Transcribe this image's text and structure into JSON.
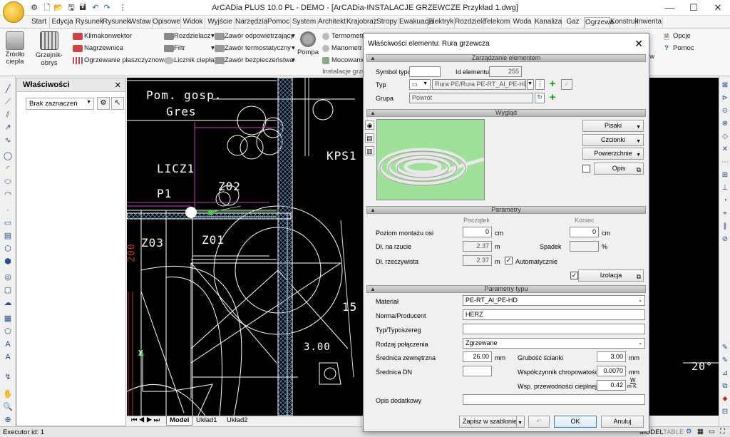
{
  "window": {
    "title": "ArCADia PLUS 10.0 PL - DEMO - [ArCADia-INSTALACJE GRZEWCZE Przykład 1.dwg]",
    "minimize": "—",
    "maximize": "☐",
    "close": "✕"
  },
  "tabs": [
    "Start",
    "Edycja",
    "Rysunek",
    "Rysunek",
    "Wstaw",
    "Opisowe",
    "Widok",
    "Wyjście",
    "Narzędzia",
    "Pomoc",
    "System",
    "Architekt",
    "Krajobraz",
    "Stropy",
    "Ewakuacja",
    "Elektryk",
    "Rozdziele",
    "Telekom",
    "Woda",
    "Kanaliza",
    "Gaz",
    "Ogrzewa",
    "Konstruk",
    "Inwenta"
  ],
  "active_tab": "Ogrzewa",
  "ribbon": {
    "zrodlo": "Źródło ciepła",
    "grzejnik": "Grzejnik-obrys",
    "klimakonwektor": "Klimakonwektor",
    "nagrzewnica": "Nagrzewnica",
    "ogrzewanie": "Ogrzewanie płaszczyznowe",
    "rozdzielacz": "Rozdzielacz",
    "filtr": "Filtr",
    "licznik": "Licznik ciepła",
    "zawor_odp": "Zawór odpowietrzający",
    "zawor_term": "Zawór termostatyczny",
    "zawor_bezp": "Zawór bezpieczeństwa",
    "pompa": "Pompa",
    "termometr": "Termometr",
    "manometr": "Manometr",
    "mocowanie": "Mocowanie",
    "group_label": "Instalacje grzew",
    "opcje": "Opcje",
    "pomoc": "Pomoc",
    "ow": "ów"
  },
  "properties": {
    "header": "Właściwości",
    "select": "Brak zaznaczeń"
  },
  "cad_labels": {
    "pom": "Pom. gosp.",
    "gres": "Gres",
    "licz": "LICZ1",
    "p1": "P1",
    "z02": "Z02",
    "z03": "Z03",
    "z01": "Z01",
    "kps": "KPS1",
    "num15": "15",
    "num300": "3.00",
    "num200": "200",
    "deg": "20°",
    "y_axis": "Y"
  },
  "model_tabs": [
    "Model",
    "Układ1",
    "Układ2"
  ],
  "status": {
    "executor": "Executor id: 1",
    "model": "MODEL",
    "table": "TABLE"
  },
  "dialog": {
    "title": "Właściwości elementu: Rura grzewcza",
    "sec_manage": "Zarządzanie elementem",
    "symbol_label": "Symbol typu",
    "symbol_value": "",
    "id_label": "Id elementu",
    "id_value": "255",
    "typ_label": "Typ",
    "typ_value": "Rura PE/Rura PE-RT_Al_PE-HD/I",
    "grupa_label": "Grupa",
    "grupa_value": "Powrót",
    "sec_look": "Wygląd",
    "pisaki": "Pisaki",
    "czcionki": "Czcionki",
    "powierzchnie": "Powierzchnie",
    "opis": "Opis",
    "sec_params": "Parametry",
    "poczatek": "Początek",
    "koniec": "Koniec",
    "poziom_label": "Poziom montażu osi",
    "poziom_start": "0",
    "poziom_end": "0",
    "unit_cm": "cm",
    "dl_rzut_label": "Dł. na rzucie",
    "dl_rzut_value": "2.37",
    "unit_m": "m",
    "spadek_label": "Spadek",
    "spadek_value": "",
    "unit_pct": "%",
    "dl_rz_label": "Dł. rzeczywista",
    "dl_rz_value": "2.37",
    "auto_label": "Automatycznie",
    "izolacja": "Izolacja",
    "sec_type": "Parametry typu",
    "material_label": "Materiał",
    "material_value": "PE-RT_Al_PE-HD",
    "norma_label": "Norma/Producent",
    "norma_value": "HERZ",
    "typ2_label": "Typ/Typoszereg",
    "typ2_value": "",
    "rodzaj_label": "Rodzaj połączenia",
    "rodzaj_value": "Zgrzewane",
    "srednica_z_label": "Średnica zewnętrzna",
    "srednica_z_value": "26.00",
    "unit_mm": "mm",
    "grubosc_label": "Grubość ścianki",
    "grubosc_value": "3.00",
    "srednica_dn_label": "Średnica DN",
    "srednica_dn_value": "",
    "chrop_label": "Współczynnik chropowatości",
    "chrop_value": "0.0070",
    "przew_label": "Wsp. przewodności cieplnej",
    "przew_value": "0.42",
    "unit_wm_top": "W",
    "unit_wm_bot": "m·K",
    "opis_dod_label": "Opis dodatkowy",
    "opis_dod_value": "",
    "save_template": "Zapisz w szablonie",
    "ok": "OK",
    "cancel": "Anuluj"
  }
}
